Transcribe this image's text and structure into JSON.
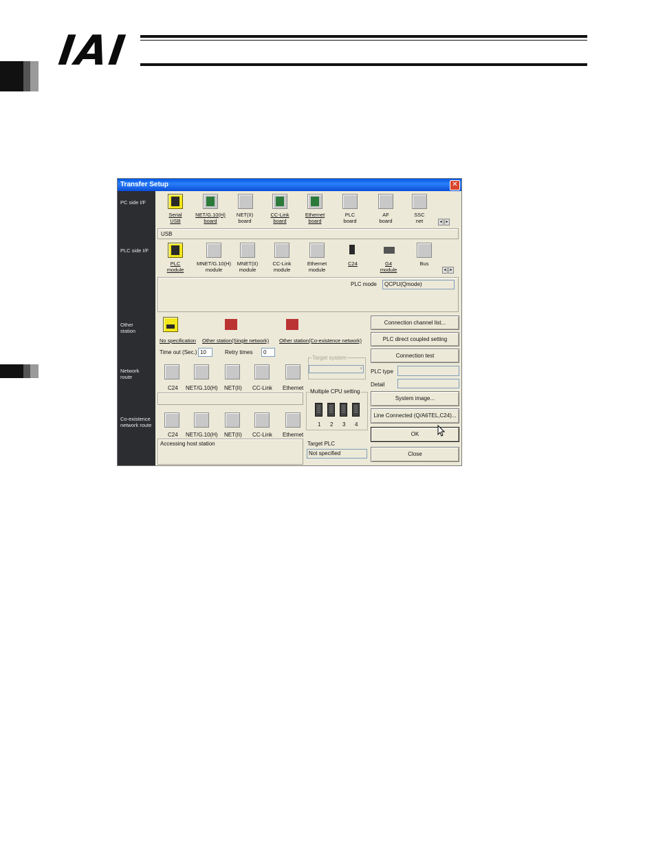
{
  "brand": "IAI",
  "window": {
    "title": "Transfer Setup",
    "close_symbol": "✕"
  },
  "nav": {
    "pc_side": "PC side I/F",
    "plc_side": "PLC side I/F",
    "other_station": "Other station",
    "network_route": "Network route",
    "coexistence_route": "Co-existence network route"
  },
  "pc_side": {
    "items": [
      {
        "line1": "Serial",
        "line2": "USB"
      },
      {
        "line1": "NET/G.10(H)",
        "line2": "board"
      },
      {
        "line1": "NET(II)",
        "line2": "board"
      },
      {
        "line1": "CC-Link",
        "line2": "board"
      },
      {
        "line1": "Ethernet",
        "line2": "board"
      },
      {
        "line1": "PLC",
        "line2": "board"
      },
      {
        "line1": "AF",
        "line2": "board"
      },
      {
        "line1": "SSC",
        "line2": "net"
      }
    ],
    "status": "USB"
  },
  "plc_side": {
    "items": [
      {
        "line1": "PLC",
        "line2": "module"
      },
      {
        "line1": "MNET/G.10(H)",
        "line2": "module"
      },
      {
        "line1": "MNET(II)",
        "line2": "module"
      },
      {
        "line1": "CC-Link",
        "line2": "module"
      },
      {
        "line1": "Ethernet",
        "line2": "module"
      },
      {
        "line1": "C24",
        "line2": ""
      },
      {
        "line1": "G4",
        "line2": "module"
      },
      {
        "line1": "Bus",
        "line2": ""
      }
    ],
    "plc_mode_label": "PLC mode",
    "plc_mode_value": "QCPU(Qmode)"
  },
  "other_station": {
    "options": [
      "No specification",
      "Other station(Single network)",
      "Other station(Co-existence network)"
    ],
    "timeout_label": "Time out (Sec.)",
    "timeout_value": "10",
    "retry_label": "Retry times",
    "retry_value": "0"
  },
  "target_system_label": "Target system",
  "network_route": {
    "items": [
      "C24",
      "NET/G.10(H)",
      "NET(II)",
      "CC-Link",
      "Ethernet"
    ]
  },
  "coexistence_route": {
    "items": [
      "C24",
      "NET/G.10(H)",
      "NET(II)",
      "CC-Link",
      "Ethernet"
    ],
    "status": "Accessing host station"
  },
  "multi_cpu": {
    "label": "Multiple CPU setting",
    "cpus": [
      "1",
      "2",
      "3",
      "4"
    ]
  },
  "target_plc": {
    "label": "Target PLC",
    "value": "Not specified"
  },
  "right": {
    "connection_channel_list": "Connection channel list...",
    "plc_direct": "PLC direct coupled setting",
    "connection_test": "Connection test",
    "plc_type_label": "PLC type",
    "detail_label": "Detail",
    "system_image": "System image...",
    "line_connected": "Line Connected (Q/A6TEL,C24)...",
    "ok": "OK",
    "close": "Close"
  }
}
